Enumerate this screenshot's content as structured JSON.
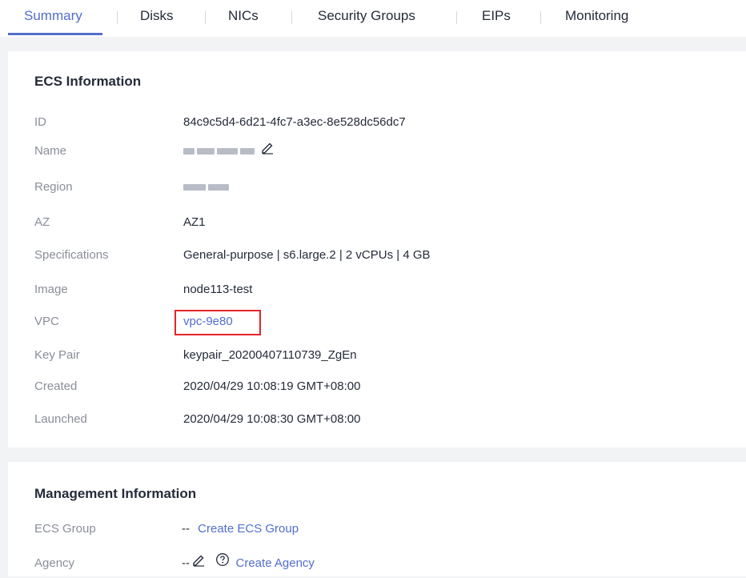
{
  "tabs": [
    {
      "label": "Summary",
      "active": true
    },
    {
      "label": "Disks",
      "active": false
    },
    {
      "label": "NICs",
      "active": false
    },
    {
      "label": "Security Groups",
      "active": false
    },
    {
      "label": "EIPs",
      "active": false
    },
    {
      "label": "Monitoring",
      "active": false
    }
  ],
  "ecs_info": {
    "title": "ECS Information",
    "rows": {
      "id": {
        "label": "ID",
        "value": "84c9c5d4-6d21-4fc7-a3ec-8e528dc56dc7"
      },
      "name": {
        "label": "Name",
        "edit_icon": "edit-pencil-icon"
      },
      "region": {
        "label": "Region"
      },
      "az": {
        "label": "AZ",
        "value": "AZ1"
      },
      "specifications": {
        "label": "Specifications",
        "value": "General-purpose | s6.large.2 | 2 vCPUs | 4 GB"
      },
      "image": {
        "label": "Image",
        "value": "node113-test"
      },
      "vpc": {
        "label": "VPC",
        "value": "vpc-9e80"
      },
      "key_pair": {
        "label": "Key Pair",
        "value": "keypair_20200407110739_ZgEn"
      },
      "created": {
        "label": "Created",
        "value": "2020/04/29 10:08:19 GMT+08:00"
      },
      "launched": {
        "label": "Launched",
        "value": "2020/04/29 10:08:30 GMT+08:00"
      }
    }
  },
  "management_info": {
    "title": "Management Information",
    "rows": {
      "ecs_group": {
        "label": "ECS Group",
        "dash": "--",
        "link": "Create ECS Group"
      },
      "agency": {
        "label": "Agency",
        "dash": "--",
        "link": "Create Agency",
        "help_icon": "question-circle-icon",
        "edit_icon": "edit-pencil-icon"
      }
    }
  },
  "colors": {
    "accent": "#526ecc",
    "label": "#8a8e99",
    "text": "#252b3a",
    "highlight_border": "#e3242b",
    "background": "#f2f3f5"
  }
}
